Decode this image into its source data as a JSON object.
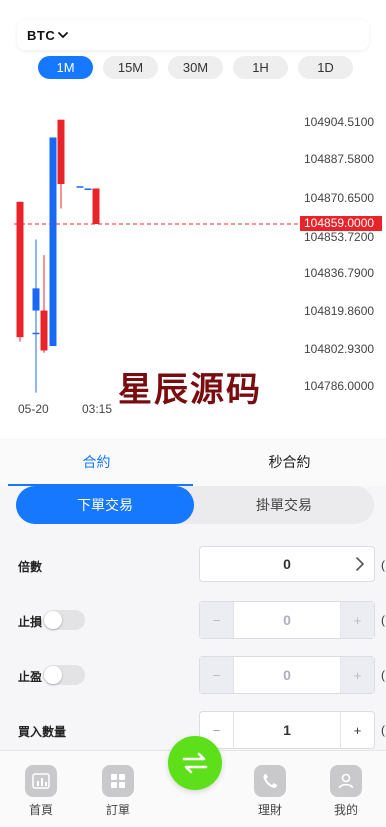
{
  "symbol": {
    "label": "BTC",
    "icon": "chevron-down-icon"
  },
  "periods": [
    {
      "label": "1M",
      "active": true
    },
    {
      "label": "15M",
      "active": false
    },
    {
      "label": "30M",
      "active": false
    },
    {
      "label": "1H",
      "active": false
    },
    {
      "label": "1D",
      "active": false
    }
  ],
  "chart": {
    "price_levels": [
      "104904.5100",
      "104887.5800",
      "104870.6500",
      "104853.7200",
      "104836.7900",
      "104819.8600",
      "104802.9300",
      "104786.0000"
    ],
    "current_price": "104859.0000",
    "time_labels": [
      "05-20",
      "03:15"
    ],
    "watermark": "星辰源码",
    "colors": {
      "up": "#1868f5",
      "down": "#e8242a",
      "current_line": "#e8242a"
    }
  },
  "chart_data": {
    "type": "candlestick",
    "y_ticks": [
      104904.51,
      104887.58,
      104870.65,
      104853.72,
      104836.79,
      104819.86,
      104802.93,
      104786.0
    ],
    "ylim": [
      104786.0,
      104904.51
    ],
    "x_tick_labels": [
      "05-20",
      "03:15"
    ],
    "current_price": 104859.0,
    "candles": [
      {
        "open": 104869,
        "close": 104808,
        "high": 104869,
        "low": 104806,
        "dir": "down"
      },
      {
        "open": 104810,
        "close": 104810,
        "high": 104852,
        "low": 104783,
        "dir": "flat"
      },
      {
        "open": 104820,
        "close": 104830,
        "high": 104830,
        "low": 104820,
        "dir": "up"
      },
      {
        "open": 104820,
        "close": 104802,
        "high": 104845,
        "low": 104801,
        "dir": "down"
      },
      {
        "open": 104804,
        "close": 104898,
        "high": 104898,
        "low": 104804,
        "dir": "up"
      },
      {
        "open": 104906,
        "close": 104877,
        "high": 104906,
        "low": 104866,
        "dir": "down"
      },
      {
        "open": 104876,
        "close": 104876,
        "high": 104876,
        "low": 104876,
        "dir": "flat"
      },
      {
        "open": 104875,
        "close": 104875,
        "high": 104875,
        "low": 104875,
        "dir": "flat"
      },
      {
        "open": 104875,
        "close": 104859,
        "high": 104875,
        "low": 104859,
        "dir": "down"
      }
    ]
  },
  "contract_tabs": [
    {
      "label": "合約",
      "active": true
    },
    {
      "label": "秒合約",
      "active": false
    }
  ],
  "order_types": [
    {
      "label": "下單交易",
      "active": true
    },
    {
      "label": "掛單交易",
      "active": false
    }
  ],
  "form": {
    "leverage": {
      "label": "倍數",
      "value": "0",
      "icon": "chevron-right-icon"
    },
    "stop_loss": {
      "label": "止損",
      "value": "0",
      "minus": "−",
      "plus": "+"
    },
    "take_profit": {
      "label": "止盈",
      "value": "0",
      "minus": "−",
      "plus": "+"
    },
    "quantity": {
      "label": "買入數量",
      "value": "1",
      "minus": "−",
      "plus": "+"
    },
    "edge_char": "("
  },
  "bottom_nav": [
    {
      "label": "首頁",
      "icon": "bar-chart-icon"
    },
    {
      "label": "訂單",
      "icon": "grid-icon"
    },
    {
      "label": "理財",
      "icon": "phone-icon"
    },
    {
      "label": "我的",
      "icon": "user-icon"
    }
  ],
  "fab": {
    "icon": "swap-arrows-icon",
    "color": "#5de01a"
  }
}
